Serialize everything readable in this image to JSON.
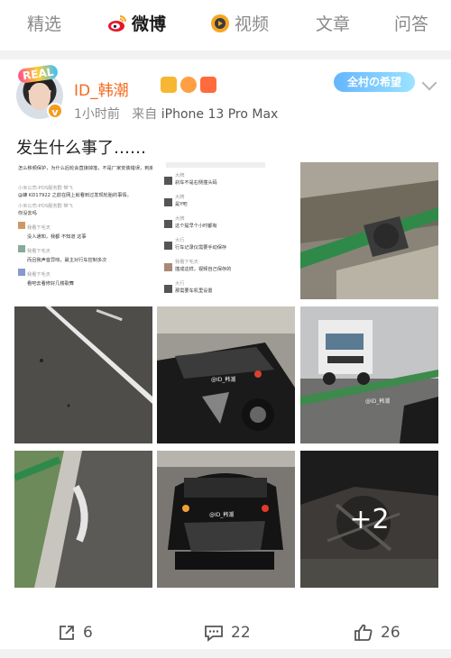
{
  "tabs": [
    {
      "label": "精选",
      "active": false
    },
    {
      "label": "微博",
      "active": true,
      "icon": "weibo-logo-icon"
    },
    {
      "label": "视频",
      "active": false,
      "icon": "video-play-icon"
    },
    {
      "label": "文章",
      "active": false
    },
    {
      "label": "问答",
      "active": false
    }
  ],
  "post": {
    "avatar_badge": "REAL",
    "username": "ID_韩潮",
    "time": "1小时前",
    "source_prefix": "来自",
    "device": "iPhone 13 Pro Max",
    "brand_badge": "全村の希望",
    "text": "发生什么事了……",
    "more_count": "+2"
  },
  "screenshot_text": {
    "col1": [
      "怎么移频保护，为什么后轮会直接掉落，不是厂家安装错误，到底是谁",
      "小米公司-POS服务群 带飞",
      "@蜂 KD17922 之前在网上就看到过发现轮胎的事情。",
      "小米公司-POS服务群 带飞",
      "你没去吗",
      "我看下毛天",
      "没人通知，我都 不知道 这事",
      "我看下毛天",
      "而且我声音异响，最主对行车控制多次",
      "我看下毛天",
      "看吧去看修好几楼歌舞"
    ],
    "col2": [
      "大牌",
      "刹车不是右侧撞头码",
      "大牌",
      "是Y吧",
      "大牌",
      "这个提早个小时都有",
      "大行",
      "行车记录仪需要手动保存",
      "我看下毛天",
      "撞成这样，视频自己保存的",
      "大行",
      "那需要车机里设置"
    ]
  },
  "watermarks": [
    "@ID_韩潮",
    "@ID_韩潮",
    "@ID_韩潮"
  ],
  "actions": {
    "share_count": "6",
    "comment_count": "22",
    "like_count": "26"
  },
  "colors": {
    "accent_orange": "#f06b1e",
    "tab_inactive": "#8a8a8a",
    "divider_bg": "#f2f2f2"
  }
}
